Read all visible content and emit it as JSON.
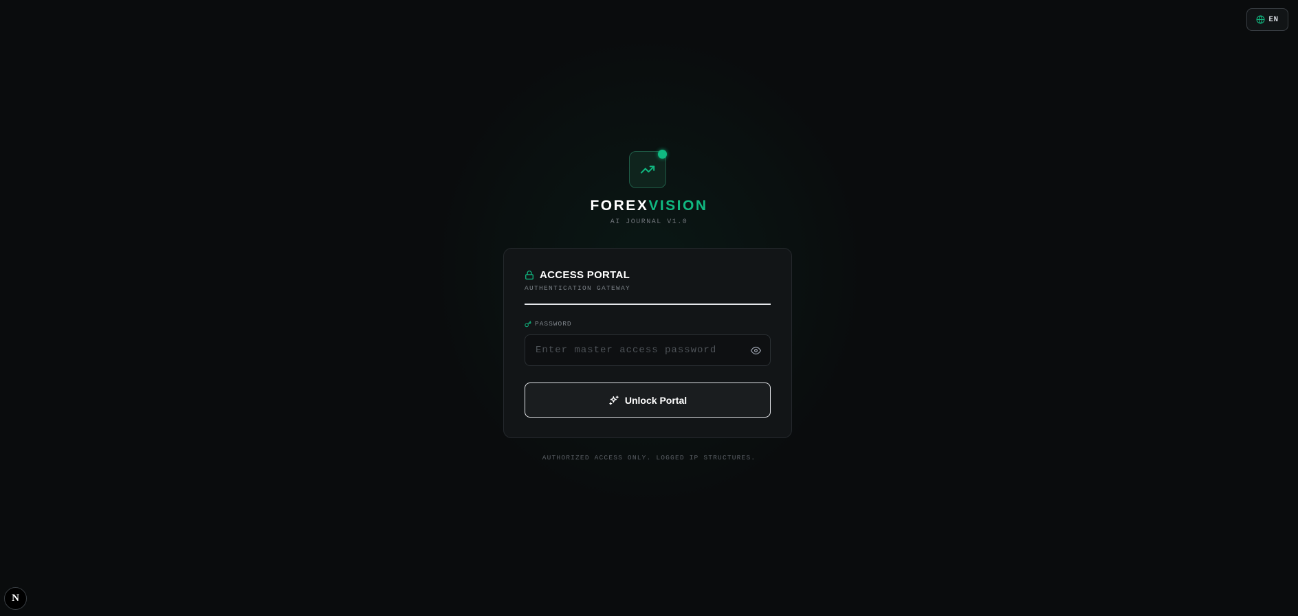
{
  "language_switcher": {
    "icon": "globe-icon",
    "label": "EN"
  },
  "brand": {
    "logo_icon": "trending-up-icon",
    "name_part1": "FOREX",
    "name_part2": "VISION",
    "tagline": "AI JOURNAL V1.0",
    "accent_color": "#10b981"
  },
  "card": {
    "title_icon": "lock-icon",
    "title": "ACCESS PORTAL",
    "subtitle": "AUTHENTICATION GATEWAY",
    "password_field": {
      "label_icon": "key-icon",
      "label": "PASSWORD",
      "value": "",
      "placeholder": "Enter master access password",
      "toggle_icon": "eye-icon"
    },
    "submit_button": {
      "icon": "sparkles-icon",
      "label": "Unlock Portal"
    }
  },
  "footer_note": "AUTHORIZED ACCESS ONLY. LOGGED IP STRUCTURES.",
  "dev_badge": {
    "icon": "nextjs-logo-icon",
    "label": "N"
  }
}
